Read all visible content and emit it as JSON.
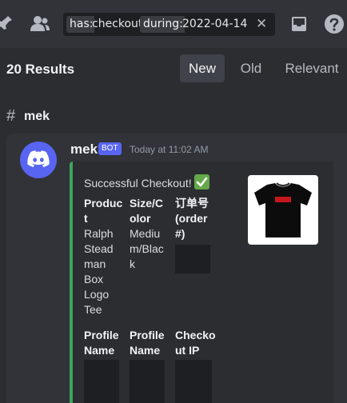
{
  "search": {
    "key1": "has:",
    "val1": "checkout",
    "key2": "during:",
    "val2": "2022-04-14",
    "clear": "✕"
  },
  "results": {
    "count_label": "20 Results",
    "sort_tabs": [
      "New",
      "Old",
      "Relevant"
    ],
    "active_tab": "New"
  },
  "channel": {
    "hash": "#",
    "name": "mek"
  },
  "message": {
    "author": "mek",
    "badge": "BOT",
    "timestamp": "Today at 11:02 AM",
    "embed": {
      "accent": "#3ba55c",
      "title": "Successful Checkout!",
      "title_emoji": "white-check-mark-icon",
      "fields": [
        {
          "name_lines": [
            "Produc",
            "t"
          ],
          "value_lines": [
            "Ralph",
            "Stead",
            "man",
            "Box",
            "Logo",
            "Tee"
          ]
        },
        {
          "name_lines": [
            "Size/C",
            "olor"
          ],
          "value_lines": [
            "Mediu",
            "m/Blac",
            "k"
          ]
        },
        {
          "name_lines": [
            "订单号",
            "(order",
            "#)"
          ],
          "value_lines": []
        },
        {
          "name_lines": [
            "Profile",
            "Name"
          ],
          "value_lines": []
        },
        {
          "name_lines": [
            "Profile",
            "Name"
          ],
          "value_lines": []
        },
        {
          "name_lines": [
            "Checko",
            "ut IP"
          ],
          "value_lines": []
        }
      ]
    }
  },
  "colors": {
    "blurple": "#5865f2",
    "background": "#2b2d31"
  }
}
